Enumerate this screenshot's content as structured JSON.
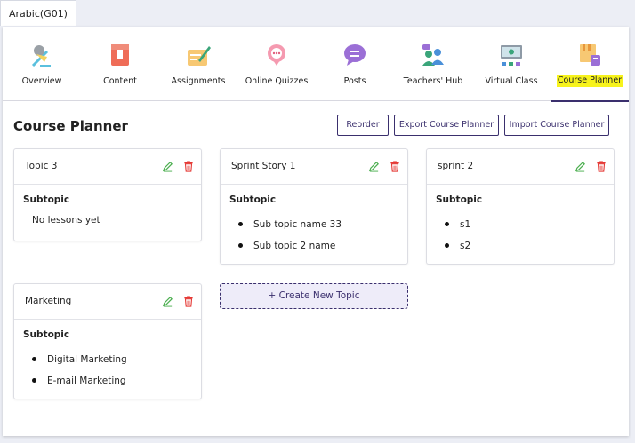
{
  "class_tab": {
    "label": "Arabic(G01)"
  },
  "nav": {
    "items": [
      {
        "label": "Overview",
        "icon": "overview-icon"
      },
      {
        "label": "Content",
        "icon": "content-icon"
      },
      {
        "label": "Assignments",
        "icon": "assignments-icon"
      },
      {
        "label": "Online Quizzes",
        "icon": "online-quizzes-icon"
      },
      {
        "label": "Posts",
        "icon": "posts-icon"
      },
      {
        "label": "Teachers' Hub",
        "icon": "teachers-hub-icon"
      },
      {
        "label": "Virtual Class",
        "icon": "virtual-class-icon"
      },
      {
        "label": "Course Planner",
        "icon": "course-planner-icon",
        "active": true
      }
    ],
    "highlight_color": "#f7f31c"
  },
  "page": {
    "title": "Course Planner",
    "buttons": {
      "reorder": "Reorder",
      "export": "Export Course Planner",
      "import": "Import Course Planner"
    }
  },
  "topics": [
    {
      "title": "Topic 3",
      "subtopic_label": "Subtopic",
      "empty_text": "No lessons yet",
      "subtopics": []
    },
    {
      "title": "Sprint Story 1",
      "subtopic_label": "Subtopic",
      "subtopics": [
        "Sub topic name 33",
        "Sub topic 2 name"
      ]
    },
    {
      "title": "sprint 2",
      "subtopic_label": "Subtopic",
      "subtopics": [
        "s1",
        "s2"
      ]
    },
    {
      "title": "Marketing",
      "subtopic_label": "Subtopic",
      "subtopics": [
        "Digital Marketing",
        "E-mail Marketing"
      ]
    }
  ],
  "create_topic": {
    "label": "+ Create New Topic"
  },
  "colors": {
    "accent": "#3a2f6d",
    "edit": "#4caf50",
    "delete": "#e53935"
  }
}
